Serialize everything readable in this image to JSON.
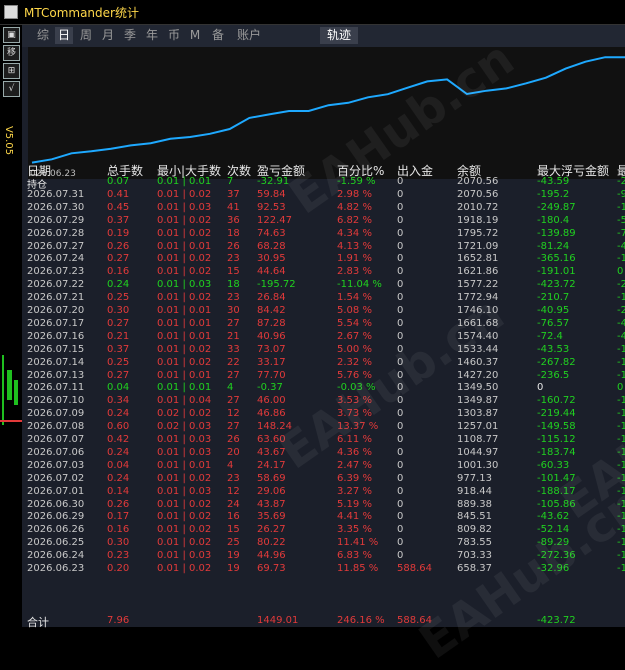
{
  "window": {
    "title": "MTCommander统计"
  },
  "left_strip": {
    "version": "V5.05",
    "buttons": [
      "▣",
      "移",
      "⊞",
      "√"
    ]
  },
  "tabs": [
    "综",
    "日",
    "周",
    "月",
    "季",
    "年",
    "币",
    "M",
    "备",
    "账户"
  ],
  "active_tab": "日",
  "track_tab": "轨迹",
  "chart": {
    "x_label": "026.06.23",
    "line_color": "#1ea9ff"
  },
  "columns": [
    "日期",
    "总手数",
    "最小|大手数",
    "次数",
    "盈亏金额",
    "百分比%",
    "出入金",
    "余额",
    "最大浮亏金额",
    "最"
  ],
  "rows": [
    {
      "date": "持仓",
      "lots": "0.07",
      "minmax": "0.01 | 0.01",
      "count": "7",
      "pnl": "-32.91",
      "pct": "-1.59 %",
      "flow": "0",
      "bal": "2070.56",
      "dd": "-43.59",
      "last": "-2",
      "c": "#20d020"
    },
    {
      "date": "2026.07.31",
      "lots": "0.41",
      "minmax": "0.01 | 0.02",
      "count": "37",
      "pnl": "59.84",
      "pct": "2.98 %",
      "flow": "0",
      "bal": "2070.56",
      "dd": "-195.2",
      "last": "-9",
      "c": "#e23a3a"
    },
    {
      "date": "2026.07.30",
      "lots": "0.45",
      "minmax": "0.01 | 0.03",
      "count": "41",
      "pnl": "92.53",
      "pct": "4.82 %",
      "flow": "0",
      "bal": "2010.72",
      "dd": "-249.87",
      "last": "-1",
      "c": "#e23a3a"
    },
    {
      "date": "2026.07.29",
      "lots": "0.37",
      "minmax": "0.01 | 0.02",
      "count": "36",
      "pnl": "122.47",
      "pct": "6.82 %",
      "flow": "0",
      "bal": "1918.19",
      "dd": "-180.4",
      "last": "-5",
      "c": "#e23a3a"
    },
    {
      "date": "2026.07.28",
      "lots": "0.19",
      "minmax": "0.01 | 0.02",
      "count": "18",
      "pnl": "74.63",
      "pct": "4.34 %",
      "flow": "0",
      "bal": "1795.72",
      "dd": "-139.89",
      "last": "-7",
      "c": "#e23a3a"
    },
    {
      "date": "2026.07.27",
      "lots": "0.26",
      "minmax": "0.01 | 0.01",
      "count": "26",
      "pnl": "68.28",
      "pct": "4.13 %",
      "flow": "0",
      "bal": "1721.09",
      "dd": "-81.24",
      "last": "-4",
      "c": "#e23a3a"
    },
    {
      "date": "2026.07.24",
      "lots": "0.27",
      "minmax": "0.01 | 0.02",
      "count": "23",
      "pnl": "30.95",
      "pct": "1.91 %",
      "flow": "0",
      "bal": "1652.81",
      "dd": "-365.16",
      "last": "-1",
      "c": "#e23a3a"
    },
    {
      "date": "2026.07.23",
      "lots": "0.16",
      "minmax": "0.01 | 0.02",
      "count": "15",
      "pnl": "44.64",
      "pct": "2.83 %",
      "flow": "0",
      "bal": "1621.86",
      "dd": "-191.01",
      "last": "0",
      "c": "#e23a3a"
    },
    {
      "date": "2026.07.22",
      "lots": "0.24",
      "minmax": "0.01 | 0.03",
      "count": "18",
      "pnl": "-195.72",
      "pct": "-11.04 %",
      "flow": "0",
      "bal": "1577.22",
      "dd": "-423.72",
      "last": "-2",
      "c": "#20d020"
    },
    {
      "date": "2026.07.21",
      "lots": "0.25",
      "minmax": "0.01 | 0.02",
      "count": "23",
      "pnl": "26.84",
      "pct": "1.54 %",
      "flow": "0",
      "bal": "1772.94",
      "dd": "-210.7",
      "last": "-1",
      "c": "#e23a3a"
    },
    {
      "date": "2026.07.20",
      "lots": "0.30",
      "minmax": "0.01 | 0.01",
      "count": "30",
      "pnl": "84.42",
      "pct": "5.08 %",
      "flow": "0",
      "bal": "1746.10",
      "dd": "-40.95",
      "last": "-2",
      "c": "#e23a3a"
    },
    {
      "date": "2026.07.17",
      "lots": "0.27",
      "minmax": "0.01 | 0.01",
      "count": "27",
      "pnl": "87.28",
      "pct": "5.54 %",
      "flow": "0",
      "bal": "1661.68",
      "dd": "-76.57",
      "last": "-4",
      "c": "#e23a3a"
    },
    {
      "date": "2026.07.16",
      "lots": "0.21",
      "minmax": "0.01 | 0.01",
      "count": "21",
      "pnl": "40.96",
      "pct": "2.67 %",
      "flow": "0",
      "bal": "1574.40",
      "dd": "-72.4",
      "last": "-4",
      "c": "#e23a3a"
    },
    {
      "date": "2026.07.15",
      "lots": "0.37",
      "minmax": "0.01 | 0.02",
      "count": "33",
      "pnl": "73.07",
      "pct": "5.00 %",
      "flow": "0",
      "bal": "1533.44",
      "dd": "-43.53",
      "last": "-1",
      "c": "#e23a3a"
    },
    {
      "date": "2026.07.14",
      "lots": "0.25",
      "minmax": "0.01 | 0.02",
      "count": "22",
      "pnl": "33.17",
      "pct": "2.32 %",
      "flow": "0",
      "bal": "1460.37",
      "dd": "-267.82",
      "last": "-1",
      "c": "#e23a3a"
    },
    {
      "date": "2026.07.13",
      "lots": "0.27",
      "minmax": "0.01 | 0.01",
      "count": "27",
      "pnl": "77.70",
      "pct": "5.76 %",
      "flow": "0",
      "bal": "1427.20",
      "dd": "-236.5",
      "last": "-1",
      "c": "#e23a3a"
    },
    {
      "date": "2026.07.11",
      "lots": "0.04",
      "minmax": "0.01 | 0.01",
      "count": "4",
      "pnl": "-0.37",
      "pct": "-0.03 %",
      "flow": "0",
      "bal": "1349.50",
      "dd": "0",
      "last": "0",
      "c": "#20d020"
    },
    {
      "date": "2026.07.10",
      "lots": "0.34",
      "minmax": "0.01 | 0.04",
      "count": "27",
      "pnl": "46.00",
      "pct": "3.53 %",
      "flow": "0",
      "bal": "1349.87",
      "dd": "-160.72",
      "last": "-1",
      "c": "#e23a3a"
    },
    {
      "date": "2026.07.09",
      "lots": "0.24",
      "minmax": "0.02 | 0.02",
      "count": "12",
      "pnl": "46.86",
      "pct": "3.73 %",
      "flow": "0",
      "bal": "1303.87",
      "dd": "-219.44",
      "last": "-1",
      "c": "#e23a3a"
    },
    {
      "date": "2026.07.08",
      "lots": "0.60",
      "minmax": "0.02 | 0.03",
      "count": "27",
      "pnl": "148.24",
      "pct": "13.37 %",
      "flow": "0",
      "bal": "1257.01",
      "dd": "-149.58",
      "last": "-1",
      "c": "#e23a3a"
    },
    {
      "date": "2026.07.07",
      "lots": "0.42",
      "minmax": "0.01 | 0.03",
      "count": "26",
      "pnl": "63.60",
      "pct": "6.11 %",
      "flow": "0",
      "bal": "1108.77",
      "dd": "-115.12",
      "last": "-1",
      "c": "#e23a3a"
    },
    {
      "date": "2026.07.06",
      "lots": "0.24",
      "minmax": "0.01 | 0.03",
      "count": "20",
      "pnl": "43.67",
      "pct": "4.36 %",
      "flow": "0",
      "bal": "1044.97",
      "dd": "-183.74",
      "last": "-1",
      "c": "#e23a3a"
    },
    {
      "date": "2026.07.03",
      "lots": "0.04",
      "minmax": "0.01 | 0.01",
      "count": "4",
      "pnl": "24.17",
      "pct": "2.47 %",
      "flow": "0",
      "bal": "1001.30",
      "dd": "-60.33",
      "last": "-1",
      "c": "#e23a3a"
    },
    {
      "date": "2026.07.02",
      "lots": "0.24",
      "minmax": "0.01 | 0.02",
      "count": "23",
      "pnl": "58.69",
      "pct": "6.39 %",
      "flow": "0",
      "bal": "977.13",
      "dd": "-101.47",
      "last": "-1",
      "c": "#e23a3a"
    },
    {
      "date": "2026.07.01",
      "lots": "0.14",
      "minmax": "0.01 | 0.03",
      "count": "12",
      "pnl": "29.06",
      "pct": "3.27 %",
      "flow": "0",
      "bal": "918.44",
      "dd": "-188.17",
      "last": "-1",
      "c": "#e23a3a"
    },
    {
      "date": "2026.06.30",
      "lots": "0.26",
      "minmax": "0.01 | 0.02",
      "count": "24",
      "pnl": "43.87",
      "pct": "5.19 %",
      "flow": "0",
      "bal": "889.38",
      "dd": "-105.86",
      "last": "-1",
      "c": "#e23a3a"
    },
    {
      "date": "2026.06.29",
      "lots": "0.17",
      "minmax": "0.01 | 0.02",
      "count": "16",
      "pnl": "35.69",
      "pct": "4.41 %",
      "flow": "0",
      "bal": "845.51",
      "dd": "-43.62",
      "last": "-1",
      "c": "#e23a3a"
    },
    {
      "date": "2026.06.26",
      "lots": "0.16",
      "minmax": "0.01 | 0.02",
      "count": "15",
      "pnl": "26.27",
      "pct": "3.35 %",
      "flow": "0",
      "bal": "809.82",
      "dd": "-52.14",
      "last": "-1",
      "c": "#e23a3a"
    },
    {
      "date": "2026.06.25",
      "lots": "0.30",
      "minmax": "0.01 | 0.02",
      "count": "25",
      "pnl": "80.22",
      "pct": "11.41 %",
      "flow": "0",
      "bal": "783.55",
      "dd": "-89.29",
      "last": "-1",
      "c": "#e23a3a"
    },
    {
      "date": "2026.06.24",
      "lots": "0.23",
      "minmax": "0.01 | 0.03",
      "count": "19",
      "pnl": "44.96",
      "pct": "6.83 %",
      "flow": "0",
      "bal": "703.33",
      "dd": "-272.36",
      "last": "-1",
      "c": "#e23a3a"
    },
    {
      "date": "2026.06.23",
      "lots": "0.20",
      "minmax": "0.01 | 0.02",
      "count": "19",
      "pnl": "69.73",
      "pct": "11.85 %",
      "flow": "588.64",
      "bal": "658.37",
      "dd": "-32.96",
      "last": "-1",
      "c": "#e23a3a"
    }
  ],
  "total": {
    "label": "合计",
    "lots": "7.96",
    "pnl": "1449.01",
    "pct": "246.16 %",
    "flow": "588.64",
    "dd": "-423.72"
  },
  "colors": {
    "up": "#e23a3a",
    "down": "#20d020",
    "header": "#e6e6e6",
    "date": "#c8c8c8",
    "accent": "#1ea9ff"
  },
  "chart_data": {
    "type": "line",
    "x_tick_label": "026.06.23",
    "series": [
      {
        "values": [
          658.37,
          703.33,
          783.55,
          809.82,
          845.51,
          889.38,
          918.44,
          977.13,
          1001.3,
          1044.97,
          1108.77,
          1257.01,
          1303.87,
          1349.87,
          1349.5,
          1427.2,
          1460.37,
          1533.44,
          1574.4,
          1661.68,
          1746.1,
          1772.94,
          1577.22,
          1621.86,
          1652.81,
          1721.09,
          1795.72,
          1918.19,
          2010.72,
          2070.56,
          2070.56
        ]
      }
    ]
  },
  "watermark": "EAHub.cn"
}
